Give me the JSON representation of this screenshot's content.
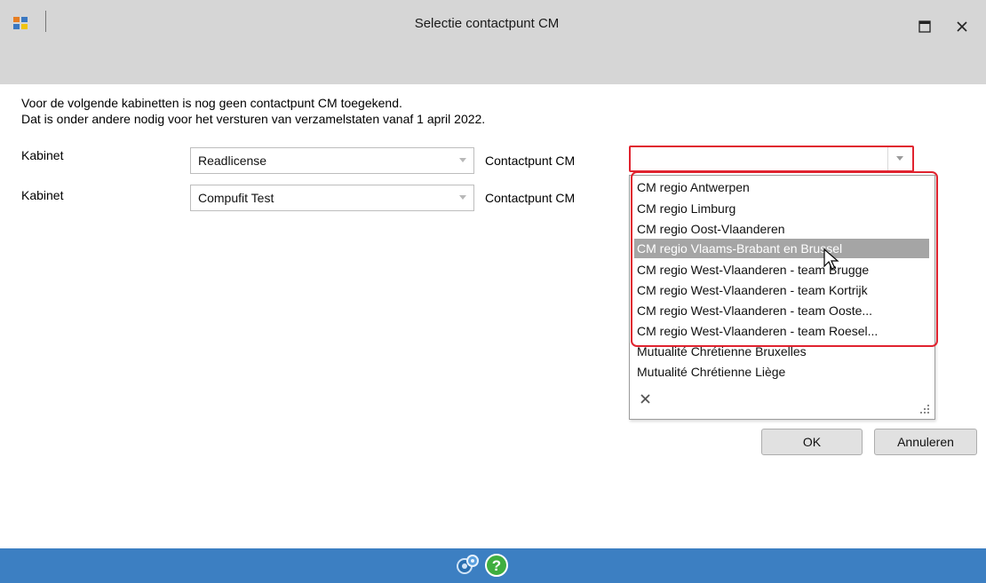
{
  "window": {
    "title": "Selectie contactpunt CM"
  },
  "message": {
    "line1": "Voor de volgende kabinetten is nog geen contactpunt CM toegekend.",
    "line2": "Dat is onder andere nodig voor het versturen van verzamelstaten vanaf 1 april 2022."
  },
  "rows": [
    {
      "kabinet_label": "Kabinet",
      "kabinet_value": "Readlicense",
      "contact_label": "Contactpunt CM",
      "contact_value": ""
    },
    {
      "kabinet_label": "Kabinet",
      "kabinet_value": "Compufit Test",
      "contact_label": "Contactpunt CM",
      "contact_value": ""
    }
  ],
  "dropdown": {
    "items": [
      "CM regio Antwerpen",
      "CM regio Limburg",
      "CM regio Oost-Vlaanderen",
      "CM regio Vlaams-Brabant en Brussel",
      "CM regio West-Vlaanderen - team Brugge",
      "CM regio West-Vlaanderen - team Kortrijk",
      "CM regio West-Vlaanderen - team Ooste...",
      "CM regio West-Vlaanderen - team Roesel...",
      "Mutualité Chrétienne Bruxelles",
      "Mutualité Chrétienne Liège"
    ],
    "highlighted_index": 3
  },
  "buttons": {
    "ok": "OK",
    "cancel": "Annuleren"
  },
  "colors": {
    "titlebar": "#d6d6d6",
    "statusbar": "#3c7fc2",
    "highlight_frame": "#e0232f",
    "selected_item": "#a5a5a5"
  },
  "icons": {
    "app": "app-window-icon",
    "settings": "settings-gears-icon",
    "help": "help-icon"
  }
}
